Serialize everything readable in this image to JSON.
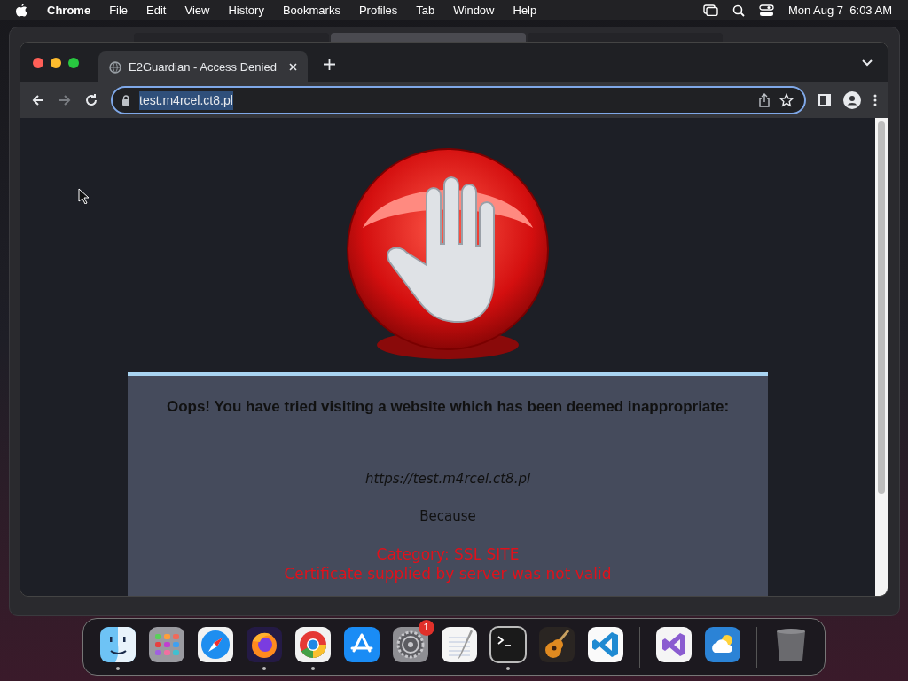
{
  "menubar": {
    "app": "Chrome",
    "menus": [
      "File",
      "Edit",
      "View",
      "History",
      "Bookmarks",
      "Profiles",
      "Tab",
      "Window",
      "Help"
    ],
    "clock": "Mon Aug 7  6:03 AM"
  },
  "background_window": {
    "tabs": [
      {
        "selected": false
      },
      {
        "selected": true
      },
      {
        "selected": false
      }
    ]
  },
  "browser": {
    "tab_title": "E2Guardian - Access Denied",
    "url": "test.m4rcel.ct8.pl"
  },
  "page": {
    "headline": "Oops! You have tried visiting a website which has been deemed inappropriate:",
    "blocked_url": "https://test.m4rcel.ct8.pl",
    "because": "Because",
    "reasons": [
      "Category: SSL SITE",
      "Certificate supplied by server was not valid"
    ]
  },
  "dock": {
    "items": [
      {
        "kind": "finder",
        "running": true
      },
      {
        "kind": "launchpad",
        "running": false
      },
      {
        "kind": "safari",
        "running": false
      },
      {
        "kind": "firefox",
        "running": true
      },
      {
        "kind": "chrome",
        "running": true
      },
      {
        "kind": "appstore",
        "running": false
      },
      {
        "kind": "settings",
        "running": false,
        "badge": "1"
      },
      {
        "kind": "textedit",
        "running": false
      },
      {
        "kind": "terminal",
        "running": true
      },
      {
        "kind": "guitar",
        "running": false
      },
      {
        "kind": "vscode",
        "running": false
      },
      {
        "kind": "separator"
      },
      {
        "kind": "visualstudio",
        "running": false
      },
      {
        "kind": "weather",
        "running": false
      },
      {
        "kind": "separator"
      },
      {
        "kind": "trash",
        "running": false
      }
    ]
  }
}
